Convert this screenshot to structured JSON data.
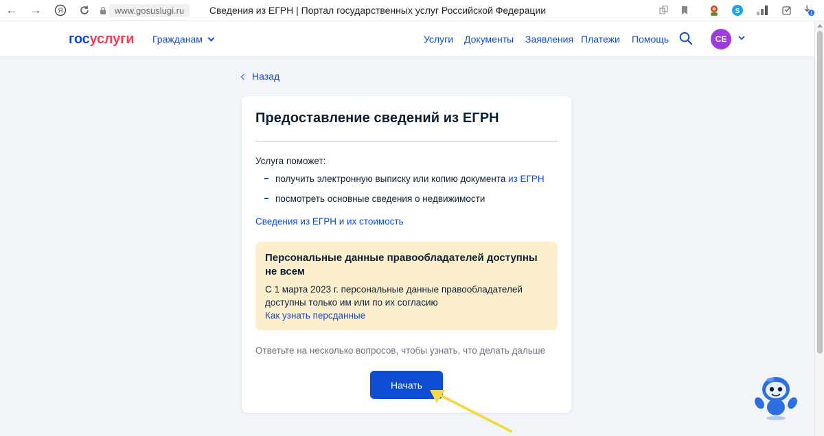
{
  "browser": {
    "url": "www.gosuslugi.ru",
    "title": "Сведения из ЕГРН | Портал государственных услуг Российской Федерации",
    "download_badge": "1"
  },
  "header": {
    "logo_part1": "гос",
    "logo_part2": "услуги",
    "citizens": "Гражданам",
    "nav": [
      "Услуги",
      "Документы",
      "Заявления",
      "Платежи",
      "Помощь"
    ],
    "avatar_initials": "СЕ"
  },
  "page": {
    "back": "Назад",
    "title": "Предоставление сведений из ЕГРН",
    "helps_intro": "Услуга поможет:",
    "bullet1_text": "получить электронную выписку или копию документа ",
    "bullet1_link": "из ЕГРН",
    "bullet2_text": "посмотреть основные сведения о недвижимости",
    "cost_link": "Сведения из ЕГРН и их стоимость",
    "notice_title": "Персональные данные правообладателей доступны не всем",
    "notice_body": "С 1 марта 2023 г. персональные данные правообладателей доступны только им или по их согласию",
    "notice_link": "Как узнать персданные",
    "answer_prompt": "Ответьте на несколько вопросов, чтобы узнать, что делать дальше",
    "start_button": "Начать"
  },
  "colors": {
    "brand_blue": "#0d4cd3",
    "brand_red": "#ee3f58",
    "avatar": "#9f39e3",
    "notice_bg": "#fdefce",
    "page_bg": "#f1f4f9",
    "annotation_arrow": "#f5d845"
  },
  "icons": [
    "back-arrow-icon",
    "forward-arrow-icon",
    "yandex-icon",
    "reload-icon",
    "lock-icon",
    "search-icon",
    "chevron-down-icon",
    "bookmark-icon",
    "download-icon",
    "robot-assistant-icon"
  ]
}
